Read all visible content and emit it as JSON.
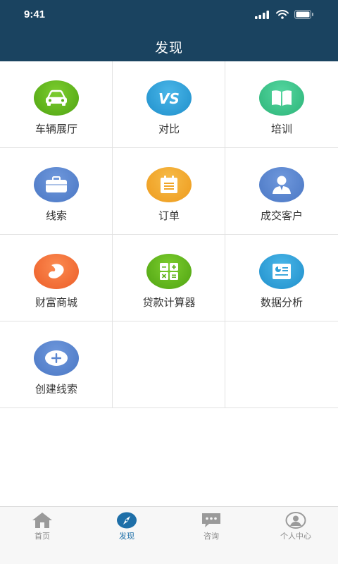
{
  "status_bar": {
    "time": "9:41"
  },
  "header": {
    "title": "发现"
  },
  "grid": {
    "items": [
      {
        "label": "车辆展厅",
        "icon": "car-icon",
        "color": "#62b51f"
      },
      {
        "label": "对比",
        "icon": "vs-icon",
        "color": "#2ea0d8"
      },
      {
        "label": "培训",
        "icon": "book-icon",
        "color": "#3cc28a"
      },
      {
        "label": "线索",
        "icon": "briefcase-icon",
        "color": "#5a86d0"
      },
      {
        "label": "订单",
        "icon": "clipboard-icon",
        "color": "#f2a92e"
      },
      {
        "label": "成交客户",
        "icon": "user-icon",
        "color": "#5a86d0"
      },
      {
        "label": "财富商城",
        "icon": "bean-icon",
        "color": "#f2703a"
      },
      {
        "label": "贷款计算器",
        "icon": "calculator-icon",
        "color": "#62b51f"
      },
      {
        "label": "数据分析",
        "icon": "report-icon",
        "color": "#2ea0d8"
      },
      {
        "label": "创建线索",
        "icon": "plus-icon",
        "color": "#5a86d0"
      }
    ]
  },
  "tabbar": {
    "tabs": [
      {
        "label": "首页",
        "icon": "home-icon",
        "active": false
      },
      {
        "label": "发现",
        "icon": "compass-icon",
        "active": true
      },
      {
        "label": "咨询",
        "icon": "chat-icon",
        "active": false
      },
      {
        "label": "个人中心",
        "icon": "profile-icon",
        "active": false
      }
    ]
  },
  "colors": {
    "header_bg": "#1a4360",
    "active_tab": "#1e6fa8",
    "inactive_tab": "#8a8a8a"
  }
}
